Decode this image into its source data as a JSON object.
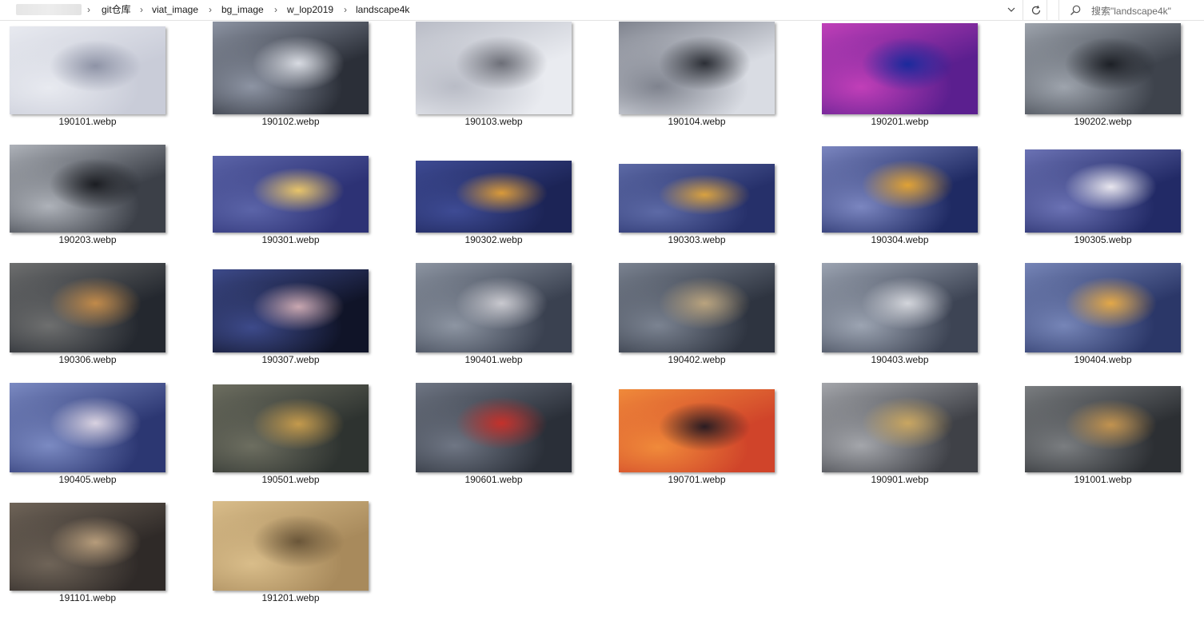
{
  "breadcrumb": {
    "items": [
      "git仓库",
      "viat_image",
      "bg_image",
      "w_lop2019",
      "landscape4k"
    ],
    "separator": "›"
  },
  "search": {
    "placeholder": "搜索\"landscape4k\""
  },
  "icons": {
    "dropdown": "chevron-down-icon",
    "refresh": "refresh-icon",
    "search": "search-icon",
    "separator": "chevron-right-icon"
  },
  "files": [
    {
      "name": "190101.webp",
      "colors": [
        "#c9ccd8",
        "#e8eaf0",
        "#8e93a6"
      ]
    },
    {
      "name": "190102.webp",
      "colors": [
        "#2b2f38",
        "#8d94a3",
        "#d8dbe2"
      ]
    },
    {
      "name": "190103.webp",
      "colors": [
        "#e9ebf0",
        "#b9bcc6",
        "#6d6f78"
      ]
    },
    {
      "name": "190104.webp",
      "colors": [
        "#d9dce3",
        "#7f838e",
        "#2c2f36"
      ]
    },
    {
      "name": "190201.webp",
      "colors": [
        "#5b1f8f",
        "#c13fb8",
        "#1b2a9c"
      ]
    },
    {
      "name": "190202.webp",
      "colors": [
        "#3e434c",
        "#9ea4ad",
        "#1d2026"
      ]
    },
    {
      "name": "190203.webp",
      "colors": [
        "#3c4048",
        "#aeb2b9",
        "#1b1d22"
      ]
    },
    {
      "name": "190301.webp",
      "colors": [
        "#2d3275",
        "#5b64a8",
        "#e7c46a"
      ]
    },
    {
      "name": "190302.webp",
      "colors": [
        "#1c2456",
        "#3e4b94",
        "#d99a3a"
      ]
    },
    {
      "name": "190303.webp",
      "colors": [
        "#26306a",
        "#5d6aa6",
        "#d8a140"
      ]
    },
    {
      "name": "190304.webp",
      "colors": [
        "#1f2a63",
        "#7b86c0",
        "#e0a235"
      ]
    },
    {
      "name": "190305.webp",
      "colors": [
        "#222a66",
        "#6b72b4",
        "#e8e6ee"
      ]
    },
    {
      "name": "190306.webp",
      "colors": [
        "#24282f",
        "#6e6f6f",
        "#c18a4a"
      ]
    },
    {
      "name": "190307.webp",
      "colors": [
        "#101428",
        "#3d4a8a",
        "#c9a7b0"
      ]
    },
    {
      "name": "190401.webp",
      "colors": [
        "#3a4150",
        "#8d95a2",
        "#c9c9cf"
      ]
    },
    {
      "name": "190402.webp",
      "colors": [
        "#2e3440",
        "#7b8391",
        "#b9a37e"
      ]
    },
    {
      "name": "190403.webp",
      "colors": [
        "#3d4454",
        "#9ca4b2",
        "#d3d5db"
      ]
    },
    {
      "name": "190404.webp",
      "colors": [
        "#2b3768",
        "#7685b7",
        "#e3a848"
      ]
    },
    {
      "name": "190405.webp",
      "colors": [
        "#2c3772",
        "#7b8ac2",
        "#d9d2e0"
      ]
    },
    {
      "name": "190501.webp",
      "colors": [
        "#2e3330",
        "#6d6e60",
        "#c49a4c"
      ]
    },
    {
      "name": "190601.webp",
      "colors": [
        "#2a2f38",
        "#6f7684",
        "#c4312b"
      ]
    },
    {
      "name": "190701.webp",
      "colors": [
        "#d0442a",
        "#f08a3a",
        "#2a1c22"
      ]
    },
    {
      "name": "190901.webp",
      "colors": [
        "#3f4147",
        "#a4a6ab",
        "#c9a661"
      ]
    },
    {
      "name": "191001.webp",
      "colors": [
        "#2c2f33",
        "#7a7d80",
        "#c2934f"
      ]
    },
    {
      "name": "191101.webp",
      "colors": [
        "#2f2a28",
        "#6f6458",
        "#b69c7b"
      ]
    },
    {
      "name": "191201.webp",
      "colors": [
        "#a88a5c",
        "#d9bd8a",
        "#6a5639"
      ]
    }
  ]
}
